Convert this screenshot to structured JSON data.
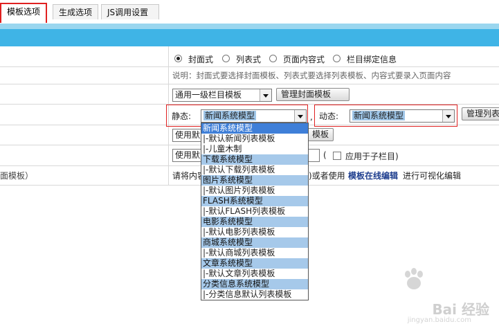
{
  "tabs": [
    {
      "label": "模板选项",
      "active": true
    },
    {
      "label": "生成选项",
      "active": false
    },
    {
      "label": "JS调用设置",
      "active": false
    }
  ],
  "mode_row": {
    "options": [
      "封面式",
      "列表式",
      "页面内容式",
      "栏目绑定信息"
    ],
    "selected": "封面式"
  },
  "note": "说明：封面式要选择封面模板、列表式要选择列表模板、内容式要录入页面内容",
  "cover_row": {
    "select_value": "通用一级栏目模板",
    "button": "管理封面模板"
  },
  "static_row": {
    "static_label": "静态:",
    "static_value": "新闻系统模型",
    "comma": ",",
    "dynamic_label": "动态:",
    "dynamic_value": "新闻系统模型",
    "button": "管理列表"
  },
  "row4": {
    "select_partial": "使用默",
    "button_partial": "模板"
  },
  "row5": {
    "select_partial": "使用默",
    "paren": "(",
    "checkbox_label": "应用于子栏目)"
  },
  "row6": {
    "left_text": "面模板）",
    "text_a": "请将内容",
    "text_b": ")或者使用",
    "link": "模板在线编辑",
    "text_c": "进行可视化编辑"
  },
  "dropdown": {
    "items": [
      {
        "label": "新闻系统模型",
        "type": "selected"
      },
      {
        "label": "|-默认新闻列表模板",
        "type": "item"
      },
      {
        "label": "|-儿童木制",
        "type": "item"
      },
      {
        "label": "下载系统模型",
        "type": "group"
      },
      {
        "label": "|-默认下载列表模板",
        "type": "item"
      },
      {
        "label": "图片系统模型",
        "type": "group"
      },
      {
        "label": "|-默认图片列表模板",
        "type": "item"
      },
      {
        "label": "FLASH系统模型",
        "type": "group"
      },
      {
        "label": "|-默认FLASH列表模板",
        "type": "item"
      },
      {
        "label": "电影系统模型",
        "type": "group"
      },
      {
        "label": "|-默认电影列表模板",
        "type": "item"
      },
      {
        "label": "商城系统模型",
        "type": "group"
      },
      {
        "label": "|-默认商城列表模板",
        "type": "item"
      },
      {
        "label": "文章系统模型",
        "type": "group"
      },
      {
        "label": "|-默认文章列表模板",
        "type": "item"
      },
      {
        "label": "分类信息系统模型",
        "type": "group"
      },
      {
        "label": "|-分类信息默认列表模板",
        "type": "item"
      }
    ]
  },
  "watermark": {
    "text": "Bai 经验",
    "sub": "jingyan.baidu.com"
  }
}
